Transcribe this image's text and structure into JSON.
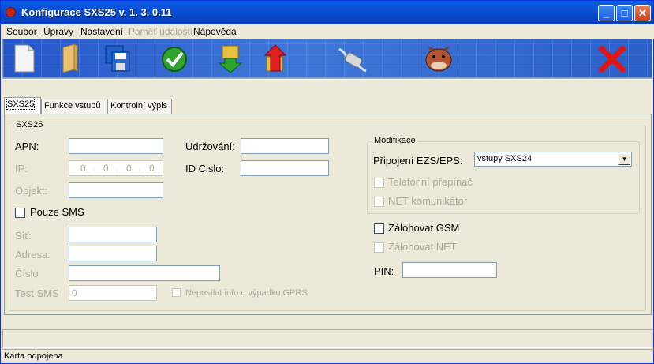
{
  "window": {
    "title": "Konfigurace SXS25 v. 1. 3. 0.11"
  },
  "menu": [
    {
      "label": "Soubor",
      "enabled": true
    },
    {
      "label": "Úpravy",
      "enabled": true
    },
    {
      "label": "Nastavení",
      "enabled": true
    },
    {
      "label": "Paměť událostí",
      "enabled": false
    },
    {
      "label": "Nápověda",
      "enabled": true
    }
  ],
  "toolbar": {
    "icons": [
      "new-document-icon",
      "open-folder-icon",
      "save-floppy-icon",
      "confirm-check-icon",
      "download-icon",
      "upload-icon",
      "serial-cable-icon",
      "bulldog-icon",
      "close-x-icon"
    ]
  },
  "tabs": [
    {
      "label": "SXS25",
      "active": true
    },
    {
      "label": "Funkce vstupů",
      "active": false
    },
    {
      "label": "Kontrolní výpis",
      "active": false
    }
  ],
  "form": {
    "group_label": "SXS25",
    "apn": {
      "label": "APN:",
      "value": ""
    },
    "ip": {
      "label": "IP:",
      "segments": [
        "0",
        "0",
        "0",
        "0"
      ]
    },
    "objekt": {
      "label": "Objekt:",
      "value": ""
    },
    "udrzovani": {
      "label": "Udržování:",
      "value": ""
    },
    "id_cislo": {
      "label": "ID Cislo:",
      "value": ""
    },
    "pouze_sms": {
      "label": "Pouze SMS",
      "checked": false
    },
    "sit": {
      "label": "Síť:",
      "value": ""
    },
    "adresa": {
      "label": "Adresa:",
      "value": ""
    },
    "cislo": {
      "label": "Číslo",
      "value": ""
    },
    "test_sms": {
      "label": "Test SMS",
      "value": "0"
    },
    "neposilat": {
      "label": "Neposílat info o výpadku GPRS",
      "checked": false
    },
    "modifikace": {
      "group_label": "Modifikace",
      "pripojeni_label": "Připojení EZS/EPS:",
      "pripojeni_value": "vstupy SXS24",
      "telefonni": "Telefonní přepínač",
      "net_kom": "NET komunikátor"
    },
    "zalohovat_gsm": "Zálohovat GSM",
    "zalohovat_net": "Zálohovat NET",
    "pin": {
      "label": "PIN:",
      "value": ""
    }
  },
  "status": {
    "text": "Karta odpojena"
  },
  "colors": {
    "title_bar": "#0a4ed6",
    "toolbar": "#2f66cf",
    "window_bg": "#ece9d8"
  }
}
